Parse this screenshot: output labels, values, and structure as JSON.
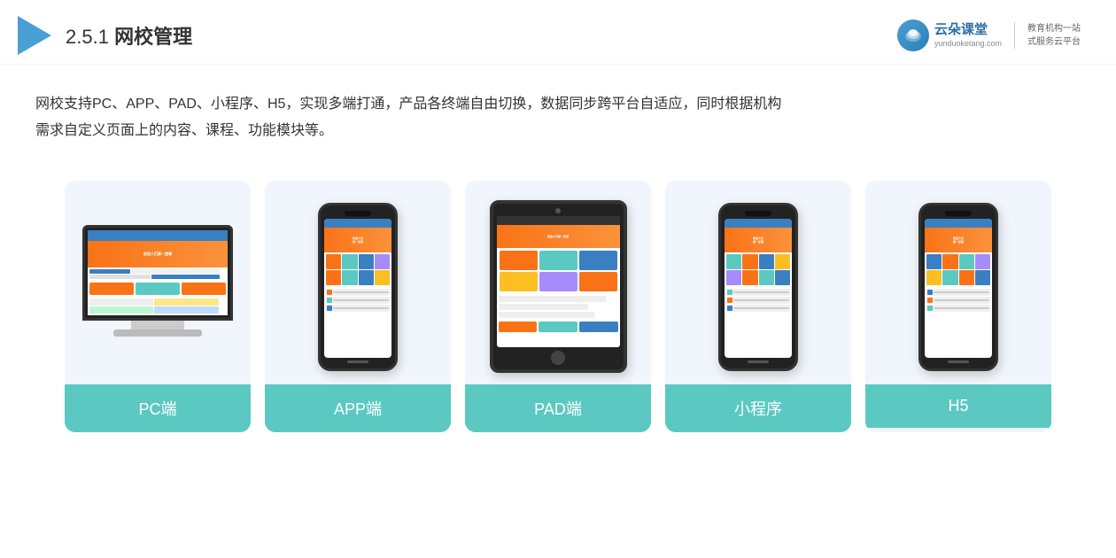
{
  "header": {
    "section_number": "2.5.1",
    "section_title": "网校管理",
    "brand_name": "云朵课堂",
    "brand_url": "yunduoketang.com",
    "brand_slogan_line1": "教育机构一站",
    "brand_slogan_line2": "式服务云平台"
  },
  "description": {
    "text_line1": "网校支持PC、APP、PAD、小程序、H5，实现多端打通，产品各终端自由切换，数据同步跨平台自适应，同时根据机构",
    "text_line2": "需求自定义页面上的内容、课程、功能模块等。"
  },
  "cards": [
    {
      "id": "pc",
      "label": "PC端",
      "device_type": "monitor"
    },
    {
      "id": "app",
      "label": "APP端",
      "device_type": "phone"
    },
    {
      "id": "pad",
      "label": "PAD端",
      "device_type": "tablet"
    },
    {
      "id": "miniprogram",
      "label": "小程序",
      "device_type": "phone"
    },
    {
      "id": "h5",
      "label": "H5",
      "device_type": "phone"
    }
  ],
  "colors": {
    "card_label_bg": "#5cc8c2",
    "accent_orange": "#f97316",
    "brand_blue": "#3a7fc1",
    "card_bg": "#eef5fb"
  }
}
